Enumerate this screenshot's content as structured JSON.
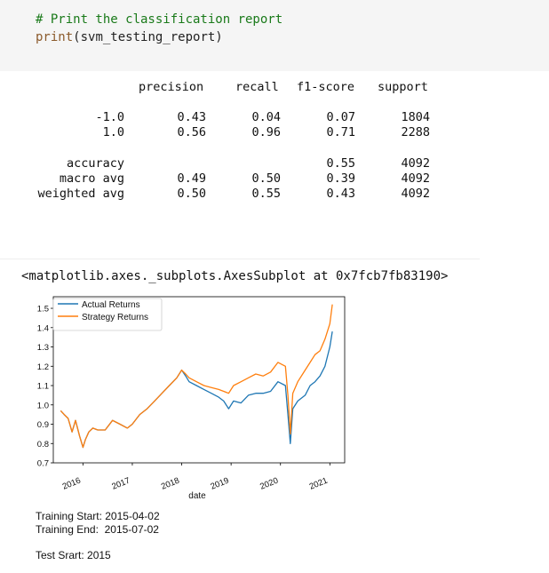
{
  "code": {
    "comment": "# Print the classification report",
    "print_fn": "print",
    "print_arg": "(svm_testing_report)"
  },
  "report": {
    "headers": [
      "precision",
      "recall",
      "f1-score",
      "support"
    ],
    "rows": [
      {
        "label": "-1.0",
        "precision": "0.43",
        "recall": "0.04",
        "f1": "0.07",
        "support": "1804"
      },
      {
        "label": "1.0",
        "precision": "0.56",
        "recall": "0.96",
        "f1": "0.71",
        "support": "2288"
      },
      {
        "label": "accuracy",
        "precision": "",
        "recall": "",
        "f1": "0.55",
        "support": "4092"
      },
      {
        "label": "macro avg",
        "precision": "0.49",
        "recall": "0.50",
        "f1": "0.39",
        "support": "4092"
      },
      {
        "label": "weighted avg",
        "precision": "0.50",
        "recall": "0.55",
        "f1": "0.43",
        "support": "4092"
      }
    ]
  },
  "axes_repr": "<matplotlib.axes._subplots.AxesSubplot at 0x7fcb7fb83190>",
  "stdout": {
    "line1": "Training Start: 2015-04-02",
    "line2": "Training End:  2015-07-02",
    "line3": "Test Srart: 2015"
  },
  "chart_data": {
    "type": "line",
    "xlabel": "date",
    "ylabel": "",
    "xlim": [
      2015.4,
      2021.3
    ],
    "ylim": [
      0.7,
      1.56
    ],
    "xticks": [
      "2016",
      "2017",
      "2018",
      "2019",
      "2020",
      "2021"
    ],
    "yticks": [
      "0.7",
      "0.8",
      "0.9",
      "1.0",
      "1.1",
      "1.2",
      "1.3",
      "1.4",
      "1.5"
    ],
    "grid": false,
    "legend_position": "upper-left",
    "series": [
      {
        "name": "Actual Returns",
        "color": "#1f77b4",
        "x": [
          2015.55,
          2015.62,
          2015.7,
          2015.78,
          2015.85,
          2015.93,
          2016.0,
          2016.05,
          2016.12,
          2016.2,
          2016.3,
          2016.45,
          2016.6,
          2016.75,
          2016.9,
          2017.0,
          2017.15,
          2017.3,
          2017.45,
          2017.6,
          2017.75,
          2017.9,
          2018.0,
          2018.08,
          2018.15,
          2018.3,
          2018.45,
          2018.6,
          2018.75,
          2018.85,
          2018.95,
          2019.05,
          2019.2,
          2019.35,
          2019.5,
          2019.65,
          2019.8,
          2019.95,
          2020.1,
          2020.15,
          2020.2,
          2020.25,
          2020.35,
          2020.5,
          2020.6,
          2020.7,
          2020.8,
          2020.9,
          2021.0,
          2021.05
        ],
        "y": [
          0.97,
          0.95,
          0.93,
          0.86,
          0.92,
          0.84,
          0.78,
          0.82,
          0.86,
          0.88,
          0.87,
          0.87,
          0.92,
          0.9,
          0.88,
          0.9,
          0.95,
          0.98,
          1.02,
          1.06,
          1.1,
          1.14,
          1.18,
          1.15,
          1.12,
          1.1,
          1.08,
          1.06,
          1.04,
          1.02,
          0.98,
          1.02,
          1.01,
          1.05,
          1.06,
          1.06,
          1.07,
          1.12,
          1.1,
          0.95,
          0.8,
          0.98,
          1.02,
          1.05,
          1.1,
          1.12,
          1.15,
          1.2,
          1.3,
          1.38
        ]
      },
      {
        "name": "Strategy Returns",
        "color": "#ff7f0e",
        "x": [
          2015.55,
          2015.62,
          2015.7,
          2015.78,
          2015.85,
          2015.93,
          2016.0,
          2016.05,
          2016.12,
          2016.2,
          2016.3,
          2016.45,
          2016.6,
          2016.75,
          2016.9,
          2017.0,
          2017.15,
          2017.3,
          2017.45,
          2017.6,
          2017.75,
          2017.9,
          2018.0,
          2018.08,
          2018.15,
          2018.3,
          2018.45,
          2018.6,
          2018.75,
          2018.85,
          2018.95,
          2019.05,
          2019.2,
          2019.35,
          2019.5,
          2019.65,
          2019.8,
          2019.95,
          2020.1,
          2020.15,
          2020.2,
          2020.25,
          2020.35,
          2020.5,
          2020.6,
          2020.7,
          2020.8,
          2020.9,
          2021.0,
          2021.05
        ],
        "y": [
          0.97,
          0.95,
          0.93,
          0.86,
          0.92,
          0.84,
          0.78,
          0.82,
          0.86,
          0.88,
          0.87,
          0.87,
          0.92,
          0.9,
          0.88,
          0.9,
          0.95,
          0.98,
          1.02,
          1.06,
          1.1,
          1.14,
          1.18,
          1.16,
          1.14,
          1.12,
          1.1,
          1.09,
          1.08,
          1.07,
          1.06,
          1.1,
          1.12,
          1.14,
          1.16,
          1.15,
          1.17,
          1.22,
          1.2,
          1.05,
          0.85,
          1.06,
          1.12,
          1.18,
          1.22,
          1.26,
          1.28,
          1.34,
          1.42,
          1.52
        ]
      }
    ]
  }
}
